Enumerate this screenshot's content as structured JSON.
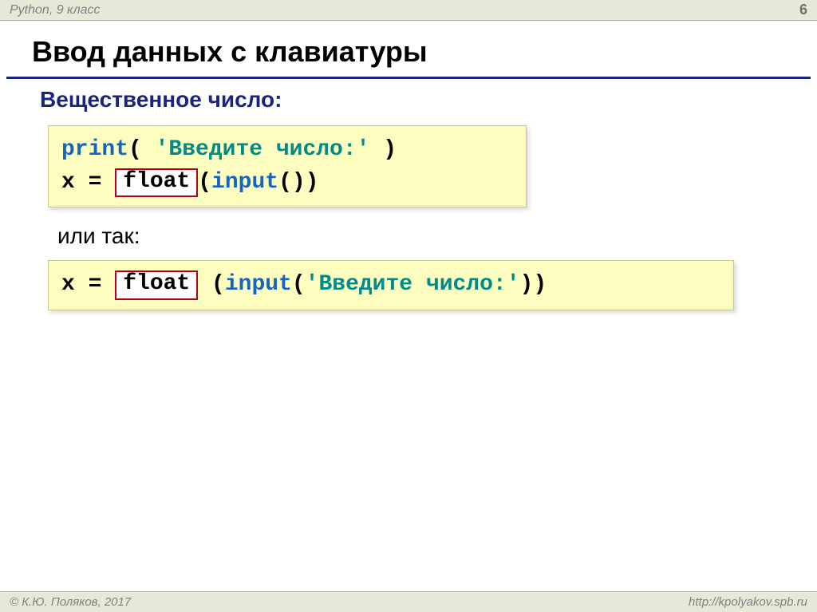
{
  "header": {
    "left": "Python, 9 класс",
    "page": "6"
  },
  "title": "Ввод данных с клавиатуры",
  "subtitle": "Вещественное число:",
  "code1": {
    "print_kw": "print",
    "paren_open": "( ",
    "string_lit": "'Введите число:'",
    "paren_close": " )",
    "line2_prefix": "x = ",
    "float_kw": "float",
    "line2_suffix_a": "(",
    "input_kw": "input",
    "line2_suffix_b": "())"
  },
  "or_text": "или так:",
  "code2": {
    "prefix": "x = ",
    "float_kw": "float",
    "mid_a": " (",
    "input_kw": "input",
    "mid_b": "(",
    "string_lit": "'Введите число:'",
    "suffix": "))"
  },
  "footer": {
    "left": "© К.Ю. Поляков, 2017",
    "right": "http://kpolyakov.spb.ru"
  }
}
